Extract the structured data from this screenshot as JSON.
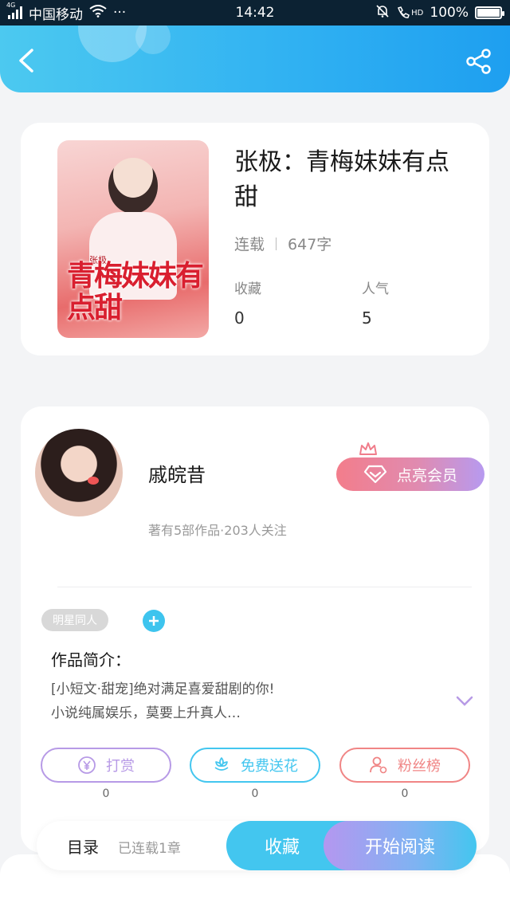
{
  "status_bar": {
    "network": "4G",
    "carrier": "中国移动",
    "more": "···",
    "time": "14:42",
    "hd": "HD",
    "battery": "100%"
  },
  "book": {
    "title": "张极：青梅妹妹有点甜",
    "status": "连载",
    "word_count": "647字",
    "favorites_label": "收藏",
    "favorites_value": "0",
    "popularity_label": "人气",
    "popularity_value": "5",
    "cover_small_text": "张极",
    "cover_title": "青梅妹妹有点甜"
  },
  "author": {
    "name": "戚皖昔",
    "meta": "著有5部作品·203人关注",
    "vip_label": "点亮会员"
  },
  "tags": [
    "明星同人"
  ],
  "intro": {
    "title": "作品简介：",
    "line1": "[小短文·甜宠]绝对满足喜爱甜剧的你!",
    "line2": "小说纯属娱乐，莫要上升真人…"
  },
  "actions": [
    {
      "label": "打赏",
      "count": "0",
      "color": "#b79ae6"
    },
    {
      "label": "免费送花",
      "count": "0",
      "color": "#43c6ef"
    },
    {
      "label": "粉丝榜",
      "count": "0",
      "color": "#f08585"
    }
  ],
  "bottom": {
    "catalog": "目录",
    "chapters": "已连载1章",
    "collect": "收藏",
    "read": "开始阅读"
  },
  "colors": {
    "header_start": "#4cc9f0",
    "header_end": "#1e9ff0",
    "accent": "#43c6ef",
    "vip_start": "#f37d8b",
    "vip_end": "#b79af0"
  }
}
